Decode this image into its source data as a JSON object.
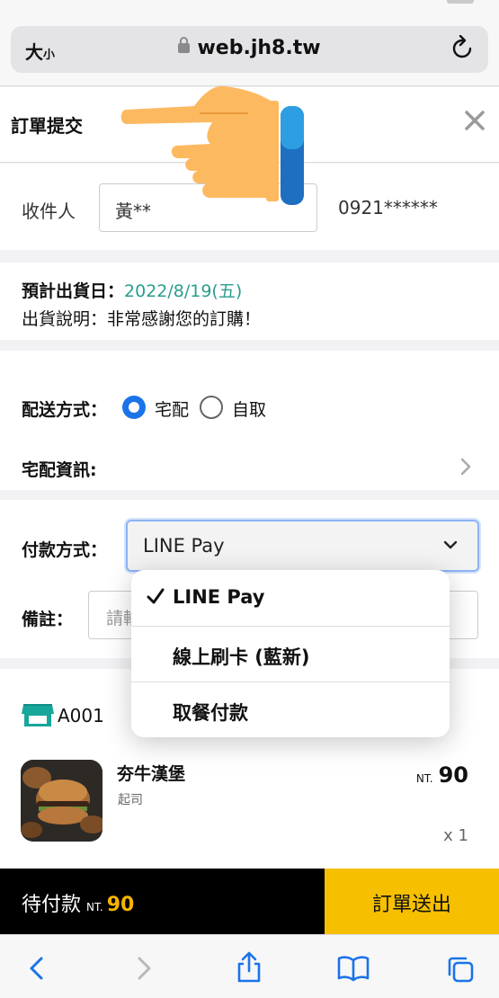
{
  "browser": {
    "text_size_label": "大",
    "text_size_small": "小",
    "url": "web.jh8.tw"
  },
  "order": {
    "title": "訂單提交"
  },
  "recipient": {
    "label": "收件人",
    "name": "黃**",
    "phone": "0921******"
  },
  "shipping": {
    "date_label": "預計出貨日：",
    "date_value": "2022/8/19(五)",
    "note": "出貨說明：非常感謝您的訂購！"
  },
  "delivery": {
    "label": "配送方式：",
    "options": [
      "宅配",
      "自取"
    ],
    "selected": "宅配",
    "info_label": "宅配資訊:"
  },
  "payment": {
    "label": "付款方式：",
    "selected": "LINE Pay",
    "options": [
      "LINE Pay",
      "線上刷卡 (藍新)",
      "取餐付款"
    ]
  },
  "memo": {
    "label": "備註：",
    "placeholder": "請輸"
  },
  "store": {
    "code": "A001"
  },
  "item": {
    "name": "夯牛漢堡",
    "option": "起司",
    "currency": "NT.",
    "price": "90",
    "qty": "x 1"
  },
  "footer": {
    "pending_label": "待付款",
    "currency": "NT.",
    "amount": "90",
    "submit_label": "訂單送出"
  },
  "colors": {
    "accent": "#1a73e8",
    "date": "#2a9d8f",
    "submit_bg": "#f6c000",
    "amount": "#f6b400",
    "store_icon": "#17a69a"
  }
}
